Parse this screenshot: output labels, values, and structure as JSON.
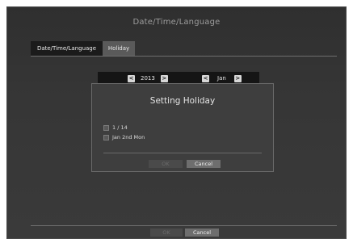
{
  "window": {
    "title": "Date/Time/Language"
  },
  "tabs": [
    {
      "label": "Date/Time/Language"
    },
    {
      "label": "Holiday"
    }
  ],
  "navigator": {
    "year": "2013",
    "month": "Jan",
    "prev_symbol": "<",
    "next_symbol": ">"
  },
  "dialog": {
    "title": "Setting Holiday",
    "items": [
      {
        "label": "1 / 14",
        "checked": false
      },
      {
        "label": "Jan 2nd Mon",
        "checked": false
      }
    ],
    "ok_label": "OK",
    "cancel_label": "Cancel"
  },
  "footer": {
    "ok_label": "OK",
    "cancel_label": "Cancel"
  }
}
